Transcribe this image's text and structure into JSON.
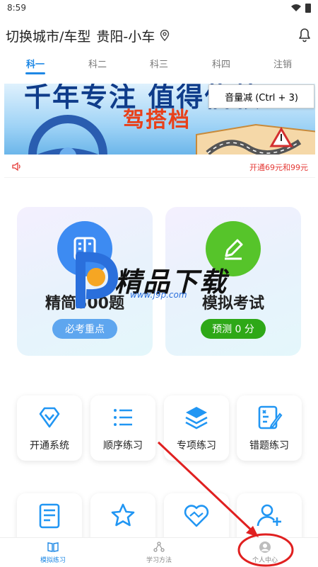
{
  "status_bar": {
    "time": "8:59"
  },
  "header": {
    "title": "切换城市/车型",
    "city": "贵阳-小车"
  },
  "tabs": [
    {
      "label": "科一",
      "active": true
    },
    {
      "label": "科二",
      "active": false
    },
    {
      "label": "科三",
      "active": false
    },
    {
      "label": "科四",
      "active": false
    },
    {
      "label": "注销",
      "active": false
    }
  ],
  "banner": {
    "top_text": "千年专注 值得信赖",
    "main_text": "驾搭档"
  },
  "tooltip": {
    "text": "音量减 (Ctrl + 3)"
  },
  "notice": {
    "text": "开通69元和99元"
  },
  "main_cards": [
    {
      "title": "精简500题",
      "pill": "必考重点",
      "color": "#3d8bf2"
    },
    {
      "title": "模拟考试",
      "pill": "预测 0 分",
      "color": "#56c42a"
    }
  ],
  "watermark": {
    "title": "精品下载",
    "url": "www.j9p.com"
  },
  "grid": [
    {
      "label": "开通系统",
      "icon": "diamond-icon"
    },
    {
      "label": "顺序练习",
      "icon": "list-icon"
    },
    {
      "label": "专项练习",
      "icon": "layers-icon"
    },
    {
      "label": "错题练习",
      "icon": "wrong-list-icon"
    },
    {
      "label": "",
      "icon": "document-icon"
    },
    {
      "label": "",
      "icon": "star-icon"
    },
    {
      "label": "",
      "icon": "handshake-heart-icon"
    },
    {
      "label": "",
      "icon": "add-user-icon"
    }
  ],
  "bottom_nav": [
    {
      "label": "模拟练习",
      "active": true
    },
    {
      "label": "学习方法",
      "active": false
    },
    {
      "label": "个人中心",
      "active": false
    }
  ],
  "colors": {
    "accent": "#1e88e5",
    "annotation_red": "#e02020",
    "notice_red": "#e53935"
  }
}
